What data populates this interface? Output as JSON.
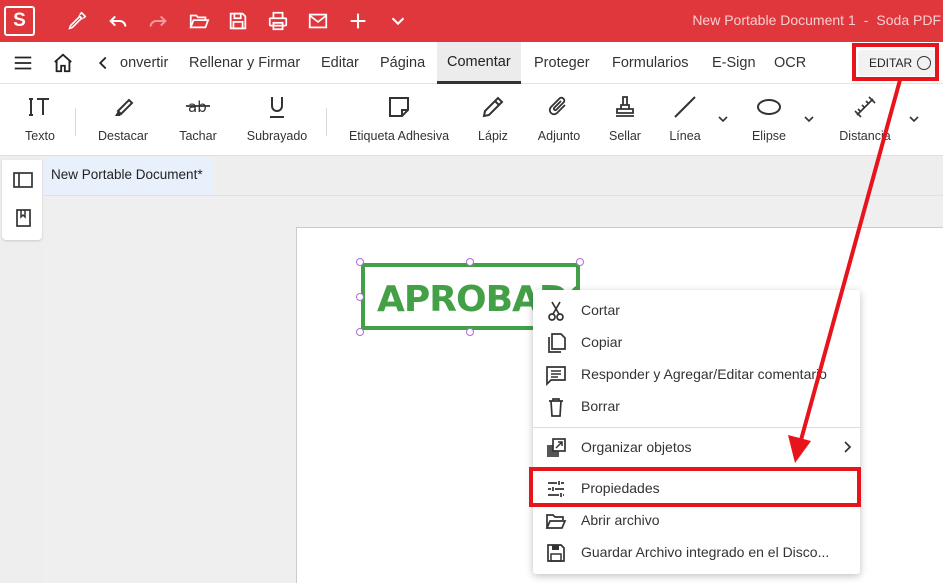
{
  "app": {
    "logo_letter": "S",
    "window_title": "New Portable Document 1",
    "app_name": "Soda PDF",
    "accent_color": "#e0373d"
  },
  "quick_toolbar": {
    "icons": [
      "sign-pen-icon",
      "undo-icon",
      "redo-icon",
      "open-folder-icon",
      "save-icon",
      "print-icon",
      "mail-icon",
      "add-icon",
      "chevron-down-icon"
    ]
  },
  "ribbon": {
    "tabs": [
      {
        "label": "onvertir"
      },
      {
        "label": "Rellenar y Firmar"
      },
      {
        "label": "Editar"
      },
      {
        "label": "Página"
      },
      {
        "label": "Comentar"
      },
      {
        "label": "Proteger"
      },
      {
        "label": "Formularios"
      },
      {
        "label": "E-Sign"
      },
      {
        "label": "OCR"
      }
    ],
    "active_tab": "Comentar",
    "editar_label": "EDITAR"
  },
  "tools": [
    {
      "label": "Texto",
      "icon": "text-icon"
    },
    {
      "label": "Destacar",
      "icon": "highlighter-icon"
    },
    {
      "label": "Tachar",
      "icon": "strikethrough-icon"
    },
    {
      "label": "Subrayado",
      "icon": "underline-icon"
    },
    {
      "label": "Etiqueta Adhesiva",
      "icon": "sticky-note-icon"
    },
    {
      "label": "Lápiz",
      "icon": "pencil-icon"
    },
    {
      "label": "Adjunto",
      "icon": "paperclip-icon"
    },
    {
      "label": "Sellar",
      "icon": "stamp-icon"
    },
    {
      "label": "Línea",
      "icon": "line-icon"
    },
    {
      "label": "Elipse",
      "icon": "ellipse-icon"
    },
    {
      "label": "Distancia",
      "icon": "distance-icon"
    }
  ],
  "document": {
    "tab_title": "New Portable Document*",
    "stamp_text": "APROBADO",
    "stamp_color": "#43a047"
  },
  "context_menu": {
    "items": [
      {
        "label": "Cortar",
        "icon": "scissors-icon"
      },
      {
        "label": "Copiar",
        "icon": "copy-icon"
      },
      {
        "label": "Responder y Agregar/Editar comentario",
        "icon": "comment-icon"
      },
      {
        "label": "Borrar",
        "icon": "trash-icon"
      },
      {
        "label": "Organizar objetos",
        "icon": "arrange-icon"
      },
      {
        "label": "Propiedades",
        "icon": "sliders-icon"
      },
      {
        "label": "Abrir archivo",
        "icon": "open-folder-icon"
      },
      {
        "label": "Guardar Archivo integrado en el Disco...",
        "icon": "save-icon"
      }
    ]
  },
  "annotation_color": "#e8141c"
}
